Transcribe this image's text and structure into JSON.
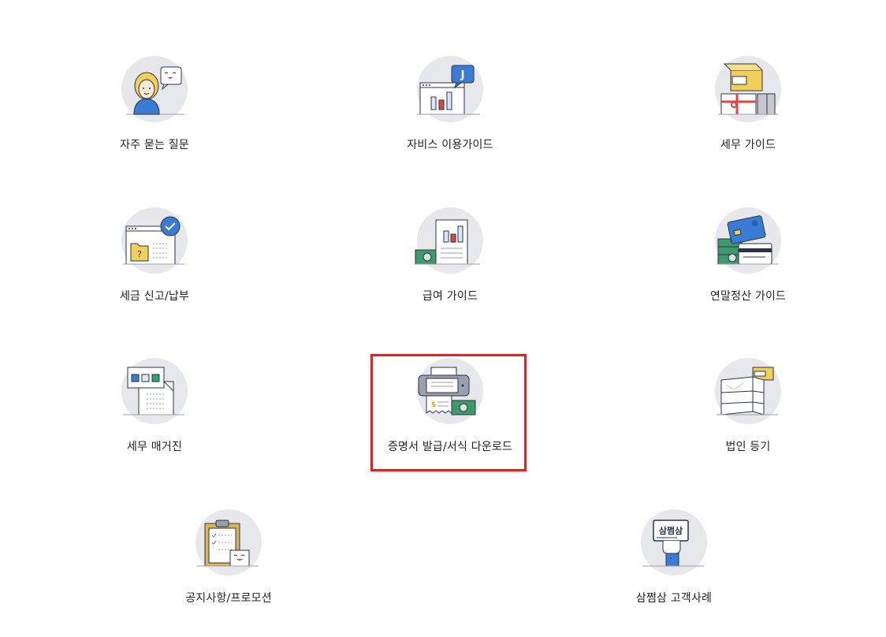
{
  "menu": {
    "items": [
      {
        "label": "자주 묻는 질문"
      },
      {
        "label": "자비스 이용가이드"
      },
      {
        "label": "세무 가이드"
      },
      {
        "label": "세금 신고/납부"
      },
      {
        "label": "급여 가이드"
      },
      {
        "label": "연말정산 가이드"
      },
      {
        "label": "세무 매거진"
      },
      {
        "label": "증명서 발급/서식 다운로드"
      },
      {
        "label": "법인 등기"
      },
      {
        "label": "공지사항/프로모션"
      },
      {
        "label": "삼쩜삼 고객사례"
      }
    ]
  },
  "icon_texts": {
    "jarvis_badge": "J",
    "samjjeomsam_sign": "삼쩜삼",
    "dollar": "$"
  },
  "colors": {
    "circle": "#e7e8ec",
    "accent_blue": "#3a7bd5",
    "accent_yellow": "#f2cf5b",
    "accent_red": "#e04545",
    "accent_green": "#3e9a6b",
    "highlight": "#e02424"
  }
}
